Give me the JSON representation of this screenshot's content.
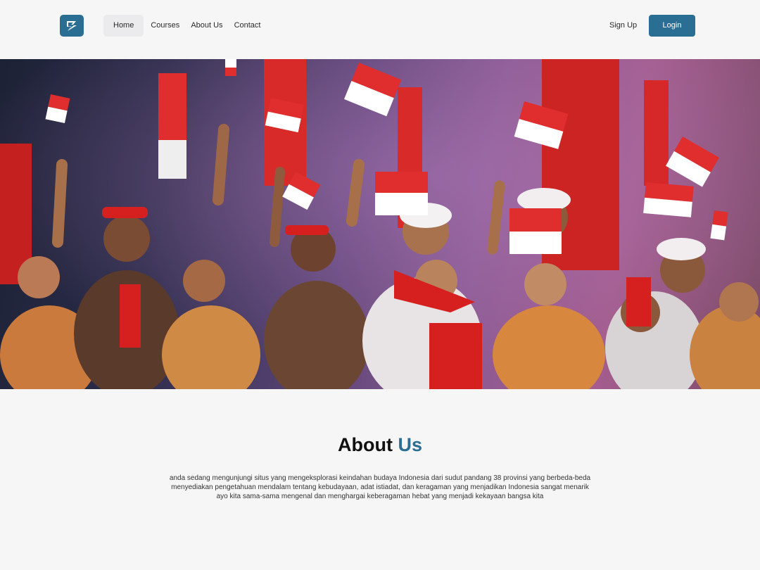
{
  "nav": {
    "links": [
      "Home",
      "Courses",
      "About Us",
      "Contact"
    ],
    "signup": "Sign Up",
    "login": "Login",
    "logo_icon": "s-logo-icon"
  },
  "hero": {
    "image": "people-waving-indonesian-flags-photo"
  },
  "about": {
    "title_main": "About",
    "title_accent": "Us",
    "lines": [
      "anda sedang mengunjungi situs yang mengeksplorasi keindahan budaya Indonesia dari sudut pandang 38 provinsi yang berbeda-beda",
      "menyediakan pengetahuan mendalam tentang kebudayaan, adat istiadat, dan keragaman yang menjadikan Indonesia sangat menarik",
      "ayo kita sama-sama mengenal dan menghargai keberagaman hebat yang menjadi kekayaan bangsa kita"
    ]
  },
  "colors": {
    "accent": "#2b6e94",
    "background": "#f6f6f7",
    "flag_red": "#e02d2d",
    "flag_white": "#ffffff"
  }
}
